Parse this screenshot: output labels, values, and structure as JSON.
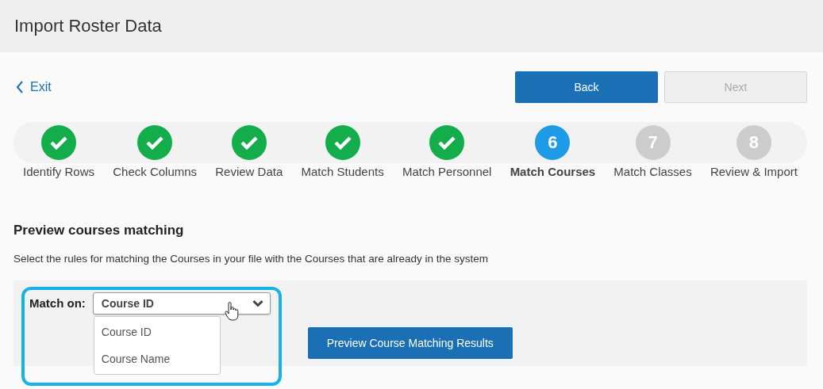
{
  "header": {
    "title": "Import Roster Data"
  },
  "nav": {
    "exit": "Exit",
    "back": {
      "label": "Back",
      "disabled": false
    },
    "next": {
      "label": "Next",
      "disabled": true
    }
  },
  "steps": [
    {
      "label": "Identify Rows",
      "kind": "done"
    },
    {
      "label": "Check Columns",
      "kind": "done"
    },
    {
      "label": "Review Data",
      "kind": "done"
    },
    {
      "label": "Match Students",
      "kind": "done"
    },
    {
      "label": "Match Personnel",
      "kind": "done"
    },
    {
      "label": "Match Courses",
      "number": "6",
      "kind": "current"
    },
    {
      "label": "Match Classes",
      "number": "7",
      "kind": "pending"
    },
    {
      "label": "Review & Import",
      "number": "8",
      "kind": "pending"
    }
  ],
  "section": {
    "heading": "Preview courses matching",
    "description": "Select the rules for matching the Courses in your file with the Courses that are already in the system"
  },
  "match": {
    "label": "Match on:",
    "value": "Course ID",
    "expanded": true,
    "options": [
      "Course ID",
      "Course Name"
    ]
  },
  "preview_button": "Preview Course Matching Results"
}
